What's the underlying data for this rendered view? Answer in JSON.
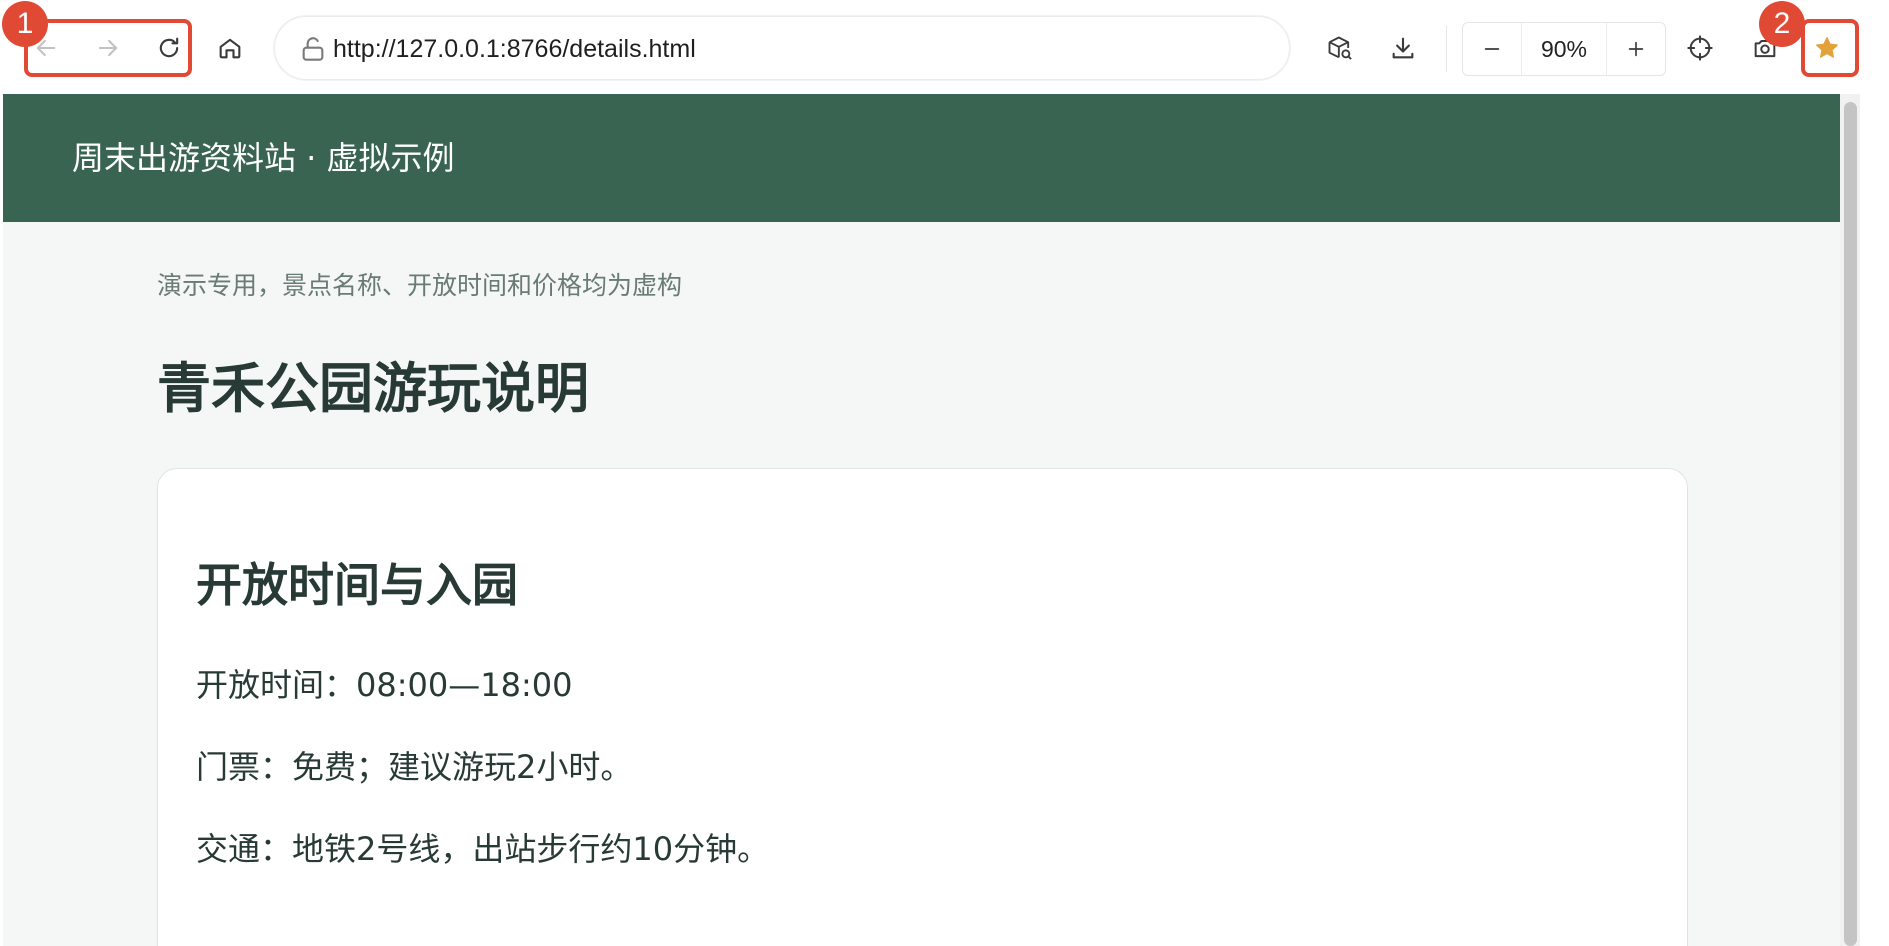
{
  "browser": {
    "url": "http://127.0.0.1:8766/details.html",
    "zoom_level": "90%",
    "icons": {
      "back": "arrow-left-icon",
      "forward": "arrow-right-icon",
      "reload": "reload-icon",
      "home": "home-icon",
      "lock": "lock-icon",
      "extensions": "package-search-icon",
      "download": "download-icon",
      "zoom_out": "minus-icon",
      "zoom_in": "plus-icon",
      "crosshair": "crosshair-icon",
      "screenshot": "camera-icon",
      "bookmark": "star-icon"
    },
    "bookmark_color": "#e3a13a"
  },
  "annotations": [
    {
      "label": "1",
      "color": "#e04a35"
    },
    {
      "label": "2",
      "color": "#e04a35"
    }
  ],
  "site": {
    "header_title": "周末出游资料站 · 虚拟示例",
    "header_color": "#386451"
  },
  "main": {
    "notice": "演示专用，景点名称、开放时间和价格均为虚构",
    "page_title": "青禾公园游玩说明",
    "card": {
      "title": "开放时间与入园",
      "lines": [
        "开放时间：08:00—18:00",
        "门票：免费；建议游玩2小时。",
        "交通：地铁2号线，出站步行约10分钟。"
      ]
    }
  }
}
